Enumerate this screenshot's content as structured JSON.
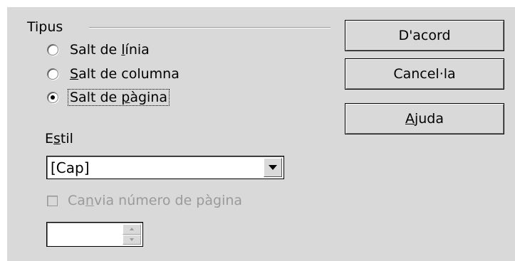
{
  "group": {
    "title": "Tipus"
  },
  "radios": [
    {
      "pre": "Salt de ",
      "ul": "l",
      "post": "ínia",
      "checked": false
    },
    {
      "pre": "",
      "ul": "S",
      "post": "alt de columna",
      "checked": false
    },
    {
      "pre": "Salt de ",
      "ul": "p",
      "post": "àgina",
      "checked": true
    }
  ],
  "style": {
    "label_pre": "E",
    "label_ul": "s",
    "label_post": "til",
    "selected": "[Cap]"
  },
  "change_page": {
    "pre": "Ca",
    "ul": "n",
    "post": "via número de pàgina",
    "checked": false,
    "enabled": false
  },
  "page_number": {
    "value": ""
  },
  "buttons": {
    "ok": {
      "pre": "D'acord",
      "ul": "",
      "post": ""
    },
    "cancel": {
      "pre": "Cancel·la",
      "ul": "",
      "post": ""
    },
    "help": {
      "pre": "",
      "ul": "A",
      "post": "juda"
    }
  }
}
